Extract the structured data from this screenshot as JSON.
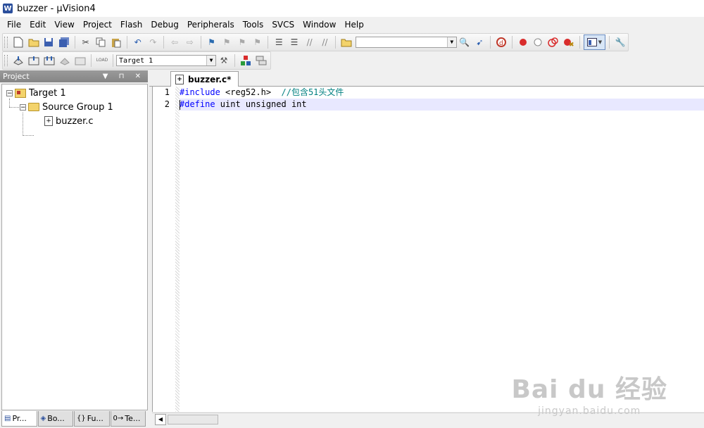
{
  "window": {
    "title": "buzzer  - µVision4"
  },
  "menu": [
    "File",
    "Edit",
    "View",
    "Project",
    "Flash",
    "Debug",
    "Peripherals",
    "Tools",
    "SVCS",
    "Window",
    "Help"
  ],
  "toolbar2": {
    "target_select": "Target 1"
  },
  "toolbar1": {
    "find_combo_value": ""
  },
  "project_panel": {
    "title": "Project",
    "tree": {
      "target": "Target 1",
      "group": "Source Group 1",
      "file": "buzzer.c"
    },
    "tabs": [
      "Pr...",
      "Bo...",
      "Fu...",
      "Te..."
    ]
  },
  "editor": {
    "tab_label": "buzzer.c*",
    "line_numbers": [
      "1",
      "2"
    ],
    "lines": [
      {
        "kw": "#include",
        "rest": " <reg52.h>  ",
        "comment": "//包含51头文件"
      },
      {
        "kw": "#define",
        "rest": " uint unsigned int",
        "comment": ""
      }
    ]
  },
  "watermark": {
    "brand": "Bai du 经验",
    "url": "jingyan.baidu.com"
  }
}
